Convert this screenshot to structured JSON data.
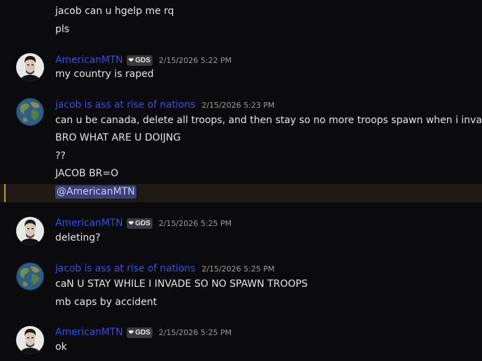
{
  "colors": {
    "background": "#0b0b0d",
    "username": "#2f4ff0",
    "mention_bg": "#3c3f79",
    "highlight_bg": "#1d1b13",
    "highlight_bar": "#c99a35"
  },
  "messages": {
    "m0": {
      "lines": [
        "jacob can u hgelp me rq",
        "pls"
      ]
    },
    "m1": {
      "username": "AmericanMTN",
      "tag": "GDS",
      "tag_icon": "heart-icon",
      "timestamp": "2/15/2026 5:22 PM",
      "lines": [
        "my country is raped"
      ]
    },
    "m2": {
      "username": "jacob is ass at rise of nations",
      "timestamp": "2/15/2026 5:23 PM",
      "lines": [
        "can u be canada, delete all troops, and then stay so no more troops spawn when i invade",
        "BRO WHAT ARE U DOIJNG",
        "??",
        "JACOB BR=O"
      ],
      "mention": "@AmericanMTN"
    },
    "m3": {
      "username": "AmericanMTN",
      "tag": "GDS",
      "timestamp": "2/15/2026 5:25 PM",
      "lines": [
        "deleting?"
      ]
    },
    "m4": {
      "username": "jacob is ass at rise of nations",
      "timestamp": "2/15/2026 5:25 PM",
      "lines": [
        "caN U STAY WHILE I INVADE SO NO SPAWN TROOPS",
        "mb caps by accident"
      ]
    },
    "m5": {
      "username": "AmericanMTN",
      "tag": "GDS",
      "timestamp": "2/15/2026 5:25 PM",
      "lines": [
        "ok"
      ]
    }
  }
}
